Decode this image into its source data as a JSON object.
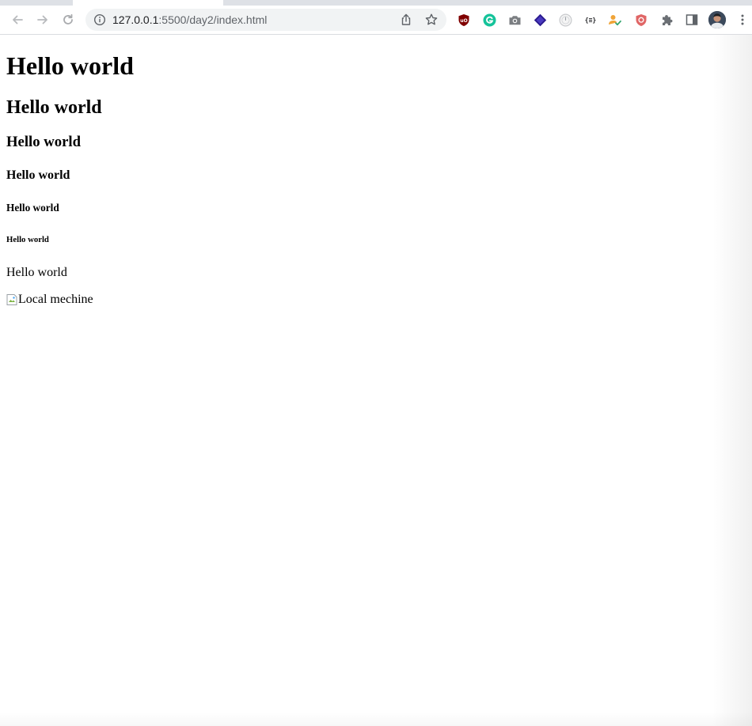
{
  "browser": {
    "url_host": "127.0.0.1",
    "url_path": ":5500/day2/index.html",
    "icons": {
      "back": "back-arrow-icon",
      "forward": "forward-arrow-icon",
      "reload": "reload-icon",
      "site_info": "info-icon",
      "share": "share-icon",
      "bookmark": "star-icon",
      "extensions": [
        "ublock-icon",
        "grammarly-icon",
        "camera-icon",
        "stack-icon",
        "timer-icon",
        "json-icon",
        "user-check-icon",
        "shield-icon",
        "puzzle-icon",
        "side-panel-icon"
      ],
      "profile": "avatar",
      "menu": "kebab-menu-icon"
    },
    "json_ext_label": "{≡}"
  },
  "page": {
    "h1": "Hello world",
    "h2": "Hello world",
    "h3": "Hello world",
    "h4": "Hello world",
    "h5": "Hello world",
    "h6": "Hello world",
    "paragraph": "Hello world",
    "image_alt": "Local mechine"
  },
  "colors": {
    "tabstrip": "#dee1e6",
    "omnibox": "#f1f3f4",
    "icon_gray": "#5f6368",
    "ublock_red": "#800000",
    "grammarly_green": "#15c39a",
    "stack_purple": "#2b1b8f",
    "shield_red": "#e06666"
  }
}
